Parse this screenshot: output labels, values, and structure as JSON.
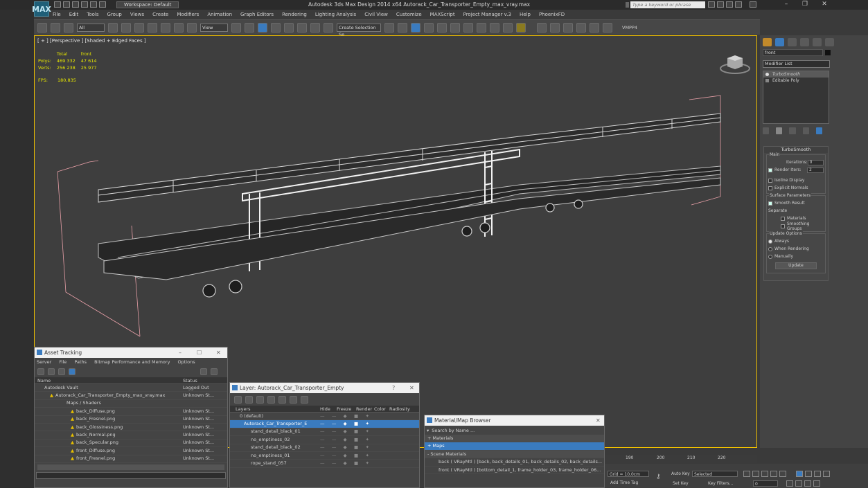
{
  "app": {
    "title": "Autodesk 3ds Max Design 2014 x64    Autorack_Car_Transporter_Empty_max_vray.max",
    "workspace": "Workspace: Default",
    "search_placeholder": "Type a keyword or phrase",
    "logo": "MAX"
  },
  "menus": [
    "File",
    "Edit",
    "Tools",
    "Group",
    "Views",
    "Create",
    "Modifiers",
    "Animation",
    "Graph Editors",
    "Rendering",
    "Lighting Analysis",
    "Civil View",
    "Customize",
    "MAXScript",
    "Project Manager v.3",
    "Help",
    "PhoenixFD"
  ],
  "toolbar": {
    "filter": "All",
    "refcoord": "View",
    "selection_set": "Create Selection Se",
    "vray_label": "VMPP4"
  },
  "viewport": {
    "label": "[ + ] [Perspective ] [Shaded + Edged Faces ]",
    "stats": {
      "col_total": "Total",
      "col_front": "front",
      "polys_label": "Polys:",
      "polys_total": "469 332",
      "polys_front": "47 614",
      "verts_label": "Verts:",
      "verts_total": "256 238",
      "verts_front": "25 977"
    },
    "fps_label": "FPS:",
    "fps": "180,835"
  },
  "command_panel": {
    "object_name": "front",
    "modifier_list": "Modifier List",
    "stack": [
      "TurboSmooth",
      "Editable Poly"
    ],
    "rollout_title": "TurboSmooth",
    "main_label": "Main",
    "iterations_label": "Iterations:",
    "iterations": "0",
    "render_iters_label": "Render Iters:",
    "render_iters": "2",
    "isoline": "Isoline Display",
    "explicit_normals": "Explicit Normals",
    "surface_params": "Surface Parameters",
    "smooth_result": "Smooth Result",
    "separate": "Separate",
    "materials": "Materials",
    "smoothing_groups": "Smoothing Groups",
    "update_options": "Update Options",
    "always": "Always",
    "when_rendering": "When Rendering",
    "manually": "Manually",
    "update_btn": "Update"
  },
  "asset_tracking": {
    "title": "Asset Tracking",
    "menu": [
      "Server",
      "File",
      "Paths",
      "Bitmap Performance and Memory",
      "Options"
    ],
    "col_name": "Name",
    "col_status": "Status",
    "rows": [
      {
        "name": "Autodesk Vault",
        "status": "Logged Out"
      },
      {
        "name": "Autorack_Car_Transporter_Empty_max_vray.max",
        "status": "Unknown St..."
      },
      {
        "name": "Maps / Shaders",
        "status": ""
      },
      {
        "name": "back_Diffuse.png",
        "status": "Unknown St..."
      },
      {
        "name": "back_Fresnel.png",
        "status": "Unknown St..."
      },
      {
        "name": "back_Glossiness.png",
        "status": "Unknown St..."
      },
      {
        "name": "back_Normal.png",
        "status": "Unknown St..."
      },
      {
        "name": "back_Specular.png",
        "status": "Unknown St..."
      },
      {
        "name": "front_Diffuse.png",
        "status": "Unknown St..."
      },
      {
        "name": "front_Fresnel.png",
        "status": "Unknown St..."
      }
    ]
  },
  "layers": {
    "title": "Layer: Autorack_Car_Transporter_Empty",
    "cols": [
      "Layers",
      "Hide",
      "Freeze",
      "Render",
      "Color",
      "Radiosity"
    ],
    "rows": [
      "0 (default)",
      "Autorack_Car_Transporter_E",
      "stand_detail_black_01",
      "no_emptiness_02",
      "stand_detail_black_02",
      "no_emptiness_01",
      "rope_stand_057"
    ]
  },
  "material_browser": {
    "title": "Material/Map Browser",
    "search": "Search by Name ...",
    "materials": "+ Materials",
    "maps": "+ Maps",
    "scene_materials": "- Scene Materials",
    "items": [
      "back ( VRayMtl ) [back, back_details_01, back_details_02, back_details...",
      "front ( VRayMtl ) [bottom_detail_1, frame_holder_03, frame_holder_06..."
    ]
  },
  "status": {
    "grid": "Grid = 10,0cm",
    "add_time_tag": "Add Time Tag",
    "auto_key": "Auto Key",
    "set_key": "Set Key",
    "selected": "Selected",
    "key_filters": "Key Filters...",
    "frame": "0",
    "ticks": [
      "190",
      "200",
      "210",
      "220"
    ]
  },
  "colors": {
    "accent": "#f0c000",
    "selection": "#3a7bbf",
    "wire": "#e8a0a8"
  }
}
